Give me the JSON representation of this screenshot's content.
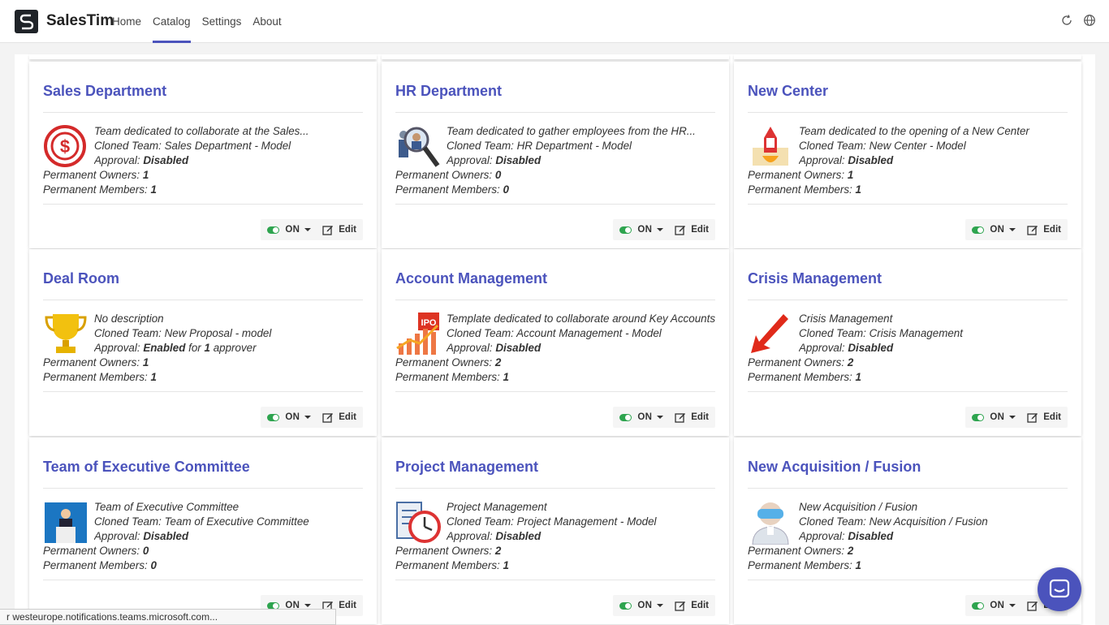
{
  "app": {
    "brand": "SalesTim"
  },
  "nav": [
    {
      "label": "Home",
      "active": false
    },
    {
      "label": "Catalog",
      "active": true
    },
    {
      "label": "Settings",
      "active": false
    },
    {
      "label": "About",
      "active": false
    }
  ],
  "topIcons": [
    "refresh-icon",
    "globe-icon"
  ],
  "accentColor": "#4b53bc",
  "toggleColor": "#2ea44f",
  "labels": {
    "cloned_team": "Cloned Team:",
    "approval": "Approval:",
    "permanent_owners": "Permanent Owners:",
    "permanent_members": "Permanent Members:",
    "for": "for",
    "approver": "approver",
    "toggle": "ON",
    "edit": "Edit"
  },
  "cards": [
    {
      "title": "Sales Department",
      "icon": "dollar-target-icon",
      "description": "Team dedicated to collaborate at the Sales...",
      "cloned": "Sales Department - Model",
      "approval": "Disabled",
      "owners": "1",
      "members": "1"
    },
    {
      "title": "HR Department",
      "icon": "people-search-icon",
      "description": "Team dedicated to gather employees from the HR...",
      "cloned": "HR Department - Model",
      "approval": "Disabled",
      "owners": "0",
      "members": "0"
    },
    {
      "title": "New Center",
      "icon": "rocket-launch-icon",
      "description": "Team dedicated to the opening of a New Center",
      "cloned": "New Center - Model",
      "approval": "Disabled",
      "owners": "1",
      "members": "1"
    },
    {
      "title": "Deal Room",
      "icon": "trophy-icon",
      "description": "No description",
      "cloned": "New Proposal - model",
      "approval": "Enabled",
      "approverCount": "1",
      "owners": "1",
      "members": "1"
    },
    {
      "title": "Account Management",
      "icon": "ipo-chart-icon",
      "description": "Template dedicated to collaborate around Key Accounts",
      "cloned": "Account Management - Model",
      "approval": "Disabled",
      "owners": "2",
      "members": "1"
    },
    {
      "title": "Crisis Management",
      "icon": "red-arrow-down-icon",
      "description": "Crisis Management",
      "cloned": "Crisis Management",
      "approval": "Disabled",
      "owners": "2",
      "members": "1"
    },
    {
      "title": "Team of Executive Committee",
      "icon": "speaker-podium-icon",
      "description": "Team of Executive Committee",
      "cloned": "Team of Executive Committee",
      "approval": "Disabled",
      "owners": "0",
      "members": "0"
    },
    {
      "title": "Project Management",
      "icon": "project-clock-icon",
      "description": "Project Management",
      "cloned": "Project Management - Model",
      "approval": "Disabled",
      "owners": "2",
      "members": "1"
    },
    {
      "title": "New Acquisition / Fusion",
      "icon": "vr-headset-person-icon",
      "description": "New Acquisition / Fusion",
      "cloned": "New Acquisition / Fusion",
      "approval": "Disabled",
      "owners": "2",
      "members": "1"
    }
  ],
  "statusTip": "r westeurope.notifications.teams.microsoft.com..."
}
